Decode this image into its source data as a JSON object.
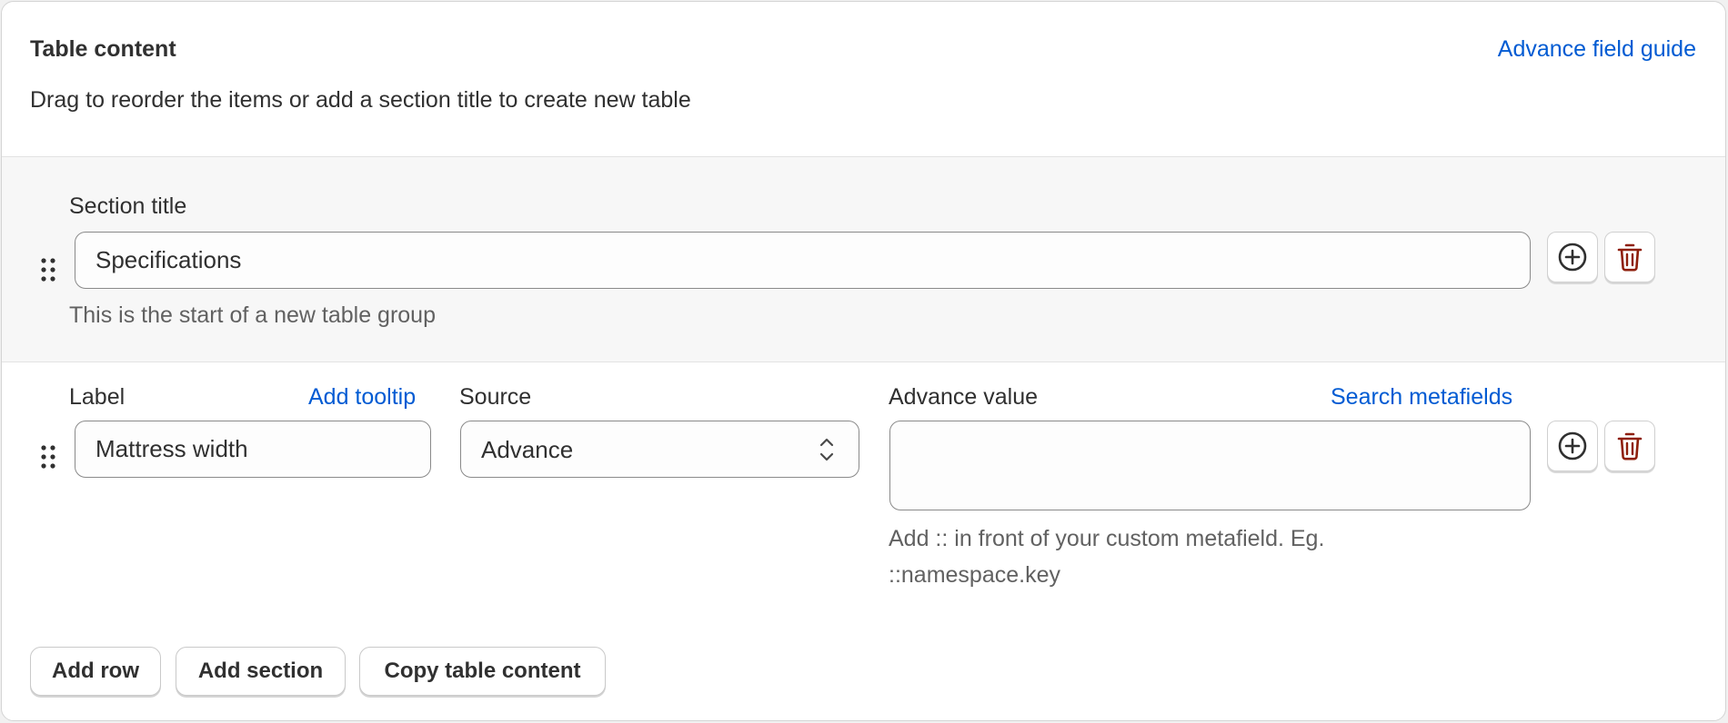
{
  "header": {
    "title": "Table content",
    "guide_link": "Advance field guide",
    "subtitle": "Drag to reorder the items or add a section title to create new table"
  },
  "section": {
    "label": "Section title",
    "value": "Specifications",
    "help": "This is the start of a new table group"
  },
  "row": {
    "label_title": "Label",
    "tooltip_link": "Add tooltip",
    "label_value": "Mattress width",
    "source_title": "Source",
    "source_value": "Advance",
    "advance_title": "Advance value",
    "metafields_link": "Search metafields",
    "advance_value": "",
    "help_line1": "Add :: in front of your custom metafield. Eg.",
    "help_line2": "::namespace.key"
  },
  "footer": {
    "add_row": "Add row",
    "add_section": "Add section",
    "copy_table": "Copy table content"
  },
  "icons": {
    "drag": "drag-handle-icon",
    "add": "plus-circle-icon",
    "delete": "trash-icon"
  },
  "colors": {
    "link": "#005bd3",
    "delete": "#8e1f0b",
    "section_bg": "#f7f7f7"
  }
}
